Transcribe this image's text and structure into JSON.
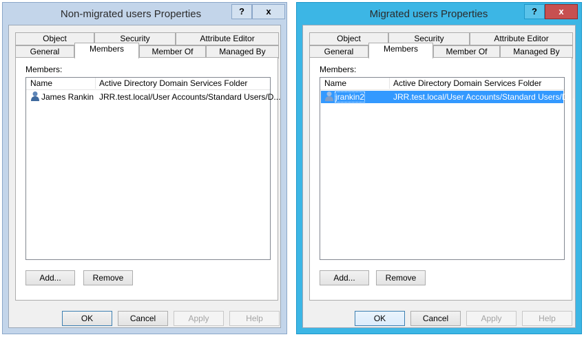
{
  "dialogs": [
    {
      "title": "Non-migrated users Properties",
      "help_label": "?",
      "close_label": "x",
      "tabs_row1": [
        "Object",
        "Security",
        "Attribute Editor"
      ],
      "tabs_row2": [
        "General",
        "Members",
        "Member Of",
        "Managed By"
      ],
      "active_tab": "Members",
      "members_label": "Members:",
      "columns": [
        "Name",
        "Active Directory Domain Services Folder"
      ],
      "rows": [
        {
          "name": "James Rankin",
          "folder": "JRR.test.local/User Accounts/Standard Users/D...",
          "selected": false
        }
      ],
      "add_label": "Add...",
      "remove_label": "Remove",
      "ok_label": "OK",
      "cancel_label": "Cancel",
      "apply_label": "Apply",
      "help_button_label": "Help"
    },
    {
      "title": "Migrated users Properties",
      "help_label": "?",
      "close_label": "x",
      "tabs_row1": [
        "Object",
        "Security",
        "Attribute Editor"
      ],
      "tabs_row2": [
        "General",
        "Members",
        "Member Of",
        "Managed By"
      ],
      "active_tab": "Members",
      "members_label": "Members:",
      "columns": [
        "Name",
        "Active Directory Domain Services Folder"
      ],
      "rows": [
        {
          "name": "jrankin2",
          "folder": "JRR.test.local/User Accounts/Standard Users/D...",
          "selected": true
        }
      ],
      "add_label": "Add...",
      "remove_label": "Remove",
      "ok_label": "OK",
      "cancel_label": "Cancel",
      "apply_label": "Apply",
      "help_button_label": "Help"
    }
  ],
  "colors": {
    "inactive_frame": "#c3d5ea",
    "active_frame": "#3cb6e5",
    "close_active": "#c75050",
    "selection": "#3399ff"
  },
  "icons": {
    "user": "user-icon"
  }
}
